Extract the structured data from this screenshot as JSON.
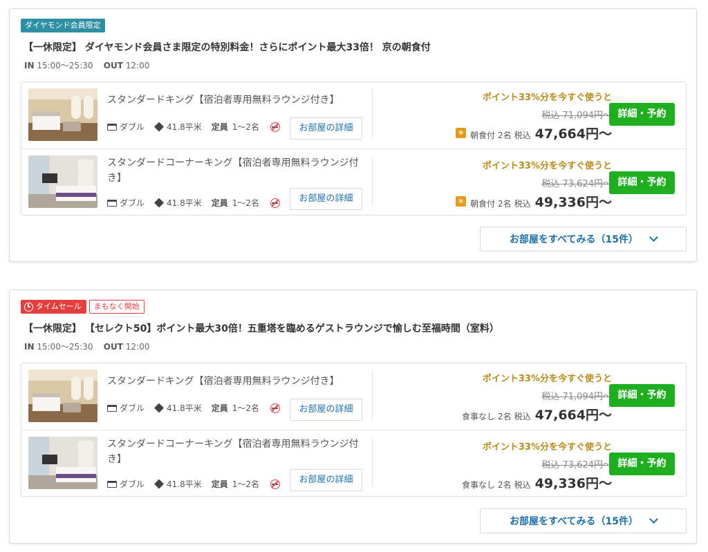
{
  "plans": [
    {
      "badges": [
        "ダイヤモンド会員限定"
      ],
      "title": "【一休限定】 ダイヤモンド会員さま限定の特別料金！さらにポイント最大33倍！ 京の朝食付",
      "checkin": {
        "in_label": "IN",
        "in_time": "15:00〜25:30",
        "out_label": "OUT",
        "out_time": "12:00"
      },
      "rooms": [
        {
          "name": "スタンダードキング【宿泊者専用無料ラウンジ付き】",
          "bed": "ダブル",
          "area": "41.8平米",
          "capacity_label": "定員",
          "capacity": "1〜2名",
          "detail_label": "お部屋の詳細",
          "point_text": "ポイント33%分を今すぐ使うと",
          "original_price": "税込 71,094円〜",
          "meal": "朝食付",
          "guests": "2名",
          "tax_label": "税込",
          "price": "47,664円〜",
          "book_label": "詳細・予約"
        },
        {
          "name": "スタンダードコーナーキング【宿泊者専用無料ラウンジ付き】",
          "bed": "ダブル",
          "area": "41.8平米",
          "capacity_label": "定員",
          "capacity": "1〜2名",
          "detail_label": "お部屋の詳細",
          "point_text": "ポイント33%分を今すぐ使うと",
          "original_price": "税込 73,624円〜",
          "meal": "朝食付",
          "guests": "2名",
          "tax_label": "税込",
          "price": "49,336円〜",
          "book_label": "詳細・予約"
        }
      ],
      "see_all": "お部屋をすべてみる（15件）"
    },
    {
      "badges": [
        "タイムセール",
        "まもなく開始"
      ],
      "title": "【一休限定】 【セレクト50】ポイント最大30倍！五重塔を臨めるゲストラウンジで愉しむ至福時間（室料）",
      "checkin": {
        "in_label": "IN",
        "in_time": "15:00〜25:30",
        "out_label": "OUT",
        "out_time": "12:00"
      },
      "rooms": [
        {
          "name": "スタンダードキング【宿泊者専用無料ラウンジ付き】",
          "bed": "ダブル",
          "area": "41.8平米",
          "capacity_label": "定員",
          "capacity": "1〜2名",
          "detail_label": "お部屋の詳細",
          "point_text": "ポイント33%分を今すぐ使うと",
          "original_price": "税込 71,094円〜",
          "meal": "食事なし",
          "guests": "2名",
          "tax_label": "税込",
          "price": "47,664円〜",
          "book_label": "詳細・予約"
        },
        {
          "name": "スタンダードコーナーキング【宿泊者専用無料ラウンジ付き】",
          "bed": "ダブル",
          "area": "41.8平米",
          "capacity_label": "定員",
          "capacity": "1〜2名",
          "detail_label": "お部屋の詳細",
          "point_text": "ポイント33%分を今すぐ使うと",
          "original_price": "税込 73,624円〜",
          "meal": "食事なし",
          "guests": "2名",
          "tax_label": "税込",
          "price": "49,336円〜",
          "book_label": "詳細・予約"
        }
      ],
      "see_all": "お部屋をすべてみる（15件）"
    }
  ],
  "colors": {
    "accent_green": "#1fae1f",
    "link_blue": "#1d6fa8",
    "point_gold": "#b88a1b",
    "sale_red": "#e33f3f",
    "diamond_teal": "#2e8fa3"
  },
  "icons": [
    "bed-icon",
    "area-icon",
    "no-smoking-icon",
    "breakfast-icon",
    "clock-icon",
    "chevron-down-icon"
  ]
}
